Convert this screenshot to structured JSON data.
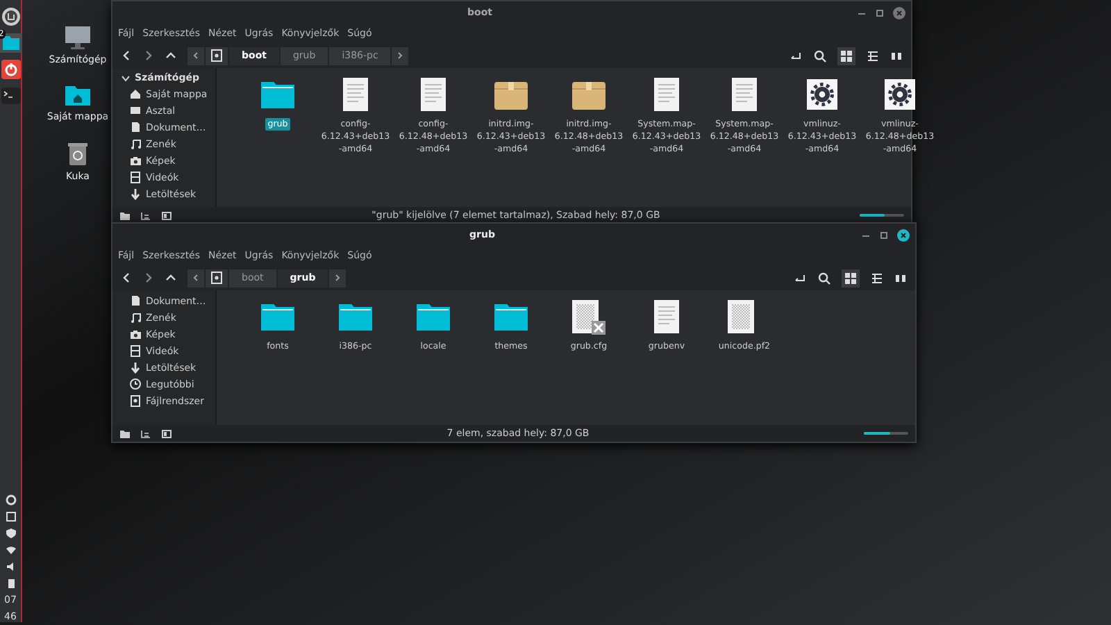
{
  "panel": {
    "launchers": [
      {
        "kind": "menu"
      },
      {
        "kind": "files",
        "badge": "2",
        "selected": true
      },
      {
        "kind": "power",
        "selected": false
      },
      {
        "kind": "terminal",
        "selected": false
      }
    ],
    "clock": [
      "07",
      "46"
    ]
  },
  "desktop_icons": [
    {
      "kind": "computer",
      "label": "Számítógép"
    },
    {
      "kind": "home",
      "label": "Saját mappa"
    },
    {
      "kind": "trash",
      "label": "Kuka"
    }
  ],
  "windows": [
    {
      "title": "boot",
      "active": false,
      "menu": [
        "Fájl",
        "Szerkesztés",
        "Nézet",
        "Ugrás",
        "Könyvjelzők",
        "Súgó"
      ],
      "path": [
        {
          "label": "boot",
          "selected": true
        },
        {
          "label": "grub",
          "selected": false
        },
        {
          "label": "i386-pc",
          "selected": false
        }
      ],
      "sidebar": {
        "header": "Számítógép",
        "expanded": true,
        "items": [
          {
            "kind": "home",
            "label": "Saját mappa"
          },
          {
            "kind": "desktop",
            "label": "Asztal"
          },
          {
            "kind": "document",
            "label": "Dokument…"
          },
          {
            "kind": "music",
            "label": "Zenék"
          },
          {
            "kind": "camera",
            "label": "Képek"
          },
          {
            "kind": "video",
            "label": "Videók"
          },
          {
            "kind": "download",
            "label": "Letöltések"
          }
        ]
      },
      "files": [
        {
          "kind": "folder",
          "label": "grub",
          "selected": true
        },
        {
          "kind": "text",
          "label": "config-\n6.12.43+deb13\n-amd64",
          "selected": false
        },
        {
          "kind": "text",
          "label": "config-\n6.12.48+deb13\n-amd64",
          "selected": false
        },
        {
          "kind": "package",
          "label": "initrd.img-\n6.12.43+deb13\n-amd64",
          "selected": false
        },
        {
          "kind": "package",
          "label": "initrd.img-\n6.12.48+deb13\n-amd64",
          "selected": false
        },
        {
          "kind": "text",
          "label": "System.map-\n6.12.43+deb13\n-amd64",
          "selected": false
        },
        {
          "kind": "text",
          "label": "System.map-\n6.12.48+deb13\n-amd64",
          "selected": false
        },
        {
          "kind": "executable",
          "label": "vmlinuz-\n6.12.43+deb13\n-amd64",
          "selected": false
        },
        {
          "kind": "executable",
          "label": "vmlinuz-\n6.12.48+deb13\n-amd64",
          "selected": false
        }
      ],
      "status": "\"grub\" kijelölve (7 elemet tartalmaz), Szabad hely: 87,0 GB",
      "zoom": {
        "level": 0.55
      }
    },
    {
      "title": "grub",
      "active": true,
      "menu": [
        "Fájl",
        "Szerkesztés",
        "Nézet",
        "Ugrás",
        "Könyvjelzők",
        "Súgó"
      ],
      "path": [
        {
          "label": "boot",
          "selected": false
        },
        {
          "label": "grub",
          "selected": true
        }
      ],
      "sidebar": {
        "items": [
          {
            "kind": "document",
            "label": "Dokument…"
          },
          {
            "kind": "music",
            "label": "Zenék"
          },
          {
            "kind": "camera",
            "label": "Képek"
          },
          {
            "kind": "video",
            "label": "Videók"
          },
          {
            "kind": "download",
            "label": "Letöltések"
          },
          {
            "kind": "clock",
            "label": "Legutóbbi"
          },
          {
            "kind": "drive",
            "label": "Fájlrendszer"
          }
        ]
      },
      "files": [
        {
          "kind": "folder",
          "label": "fonts",
          "selected": false
        },
        {
          "kind": "folder",
          "label": "i386-pc",
          "selected": false
        },
        {
          "kind": "folder",
          "label": "locale",
          "selected": false
        },
        {
          "kind": "folder",
          "label": "themes",
          "selected": false
        },
        {
          "kind": "pattern",
          "label": "grub.cfg",
          "emblem": true,
          "selected": false
        },
        {
          "kind": "text",
          "label": "grubenv",
          "selected": false
        },
        {
          "kind": "pattern",
          "label": "unicode.pf2",
          "emblem": false,
          "selected": false
        }
      ],
      "status": "7 elem, szabad hely: 87,0 GB",
      "zoom": {
        "level": 0.6
      }
    }
  ]
}
